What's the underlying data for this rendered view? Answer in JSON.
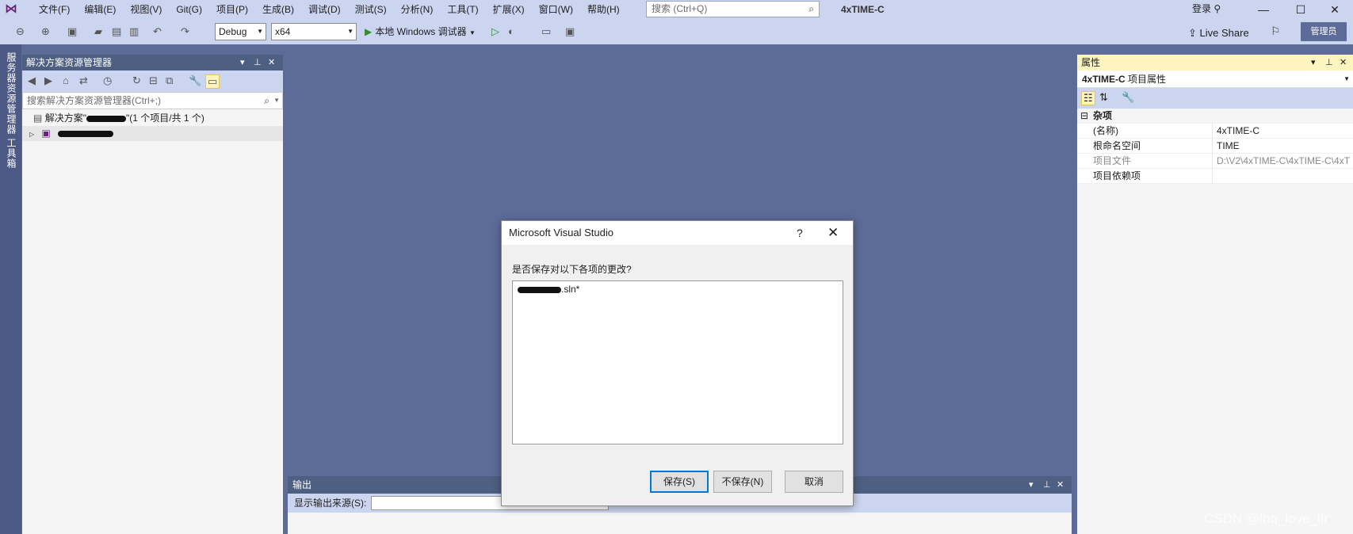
{
  "menubar": {
    "items": [
      "文件(F)",
      "编辑(E)",
      "视图(V)",
      "Git(G)",
      "项目(P)",
      "生成(B)",
      "调试(D)",
      "测试(S)",
      "分析(N)",
      "工具(T)",
      "扩展(X)",
      "窗口(W)",
      "帮助(H)"
    ],
    "search_placeholder": "搜索 (Ctrl+Q)",
    "window_title": "4xTIME-C",
    "login": "登录"
  },
  "toolbar": {
    "config": "Debug",
    "platform": "x64",
    "run_label": "本地 Windows 调试器",
    "live_share": "Live Share",
    "admin": "管理员"
  },
  "left_tabs": [
    "服务器资源管理器",
    "工具箱"
  ],
  "solution_explorer": {
    "title": "解决方案资源管理器",
    "search_placeholder": "搜索解决方案资源管理器(Ctrl+;)",
    "solution_prefix": "解决方案\"",
    "solution_suffix": "\"(1 个项目/共 1 个)"
  },
  "properties": {
    "title": "属性",
    "object_name": "4xTIME-C",
    "object_type": "项目属性",
    "category": "杂项",
    "rows": [
      {
        "key": "(名称)",
        "value": "4xTIME-C"
      },
      {
        "key": "根命名空间",
        "value": "TIME"
      },
      {
        "key": "项目文件",
        "value": "D:\\V2\\4xTIME-C\\4xTIME-C\\4xT"
      },
      {
        "key": "项目依赖项",
        "value": ""
      }
    ]
  },
  "output": {
    "title": "输出",
    "source_label": "显示输出来源(S):"
  },
  "dialog": {
    "title": "Microsoft Visual Studio",
    "help": "?",
    "message": "是否保存对以下各项的更改?",
    "item_suffix": ".sln*",
    "buttons": {
      "save": "保存(S)",
      "dont_save": "不保存(N)",
      "cancel": "取消"
    }
  },
  "watermark": "CSDN @lhq_love_lfr",
  "colors": {
    "chrome": "#ccd5f0",
    "canvas": "#5d6b99",
    "pane_header": "#4d6082",
    "selected_header": "#fdf4bf",
    "accent": "#0078d7"
  }
}
